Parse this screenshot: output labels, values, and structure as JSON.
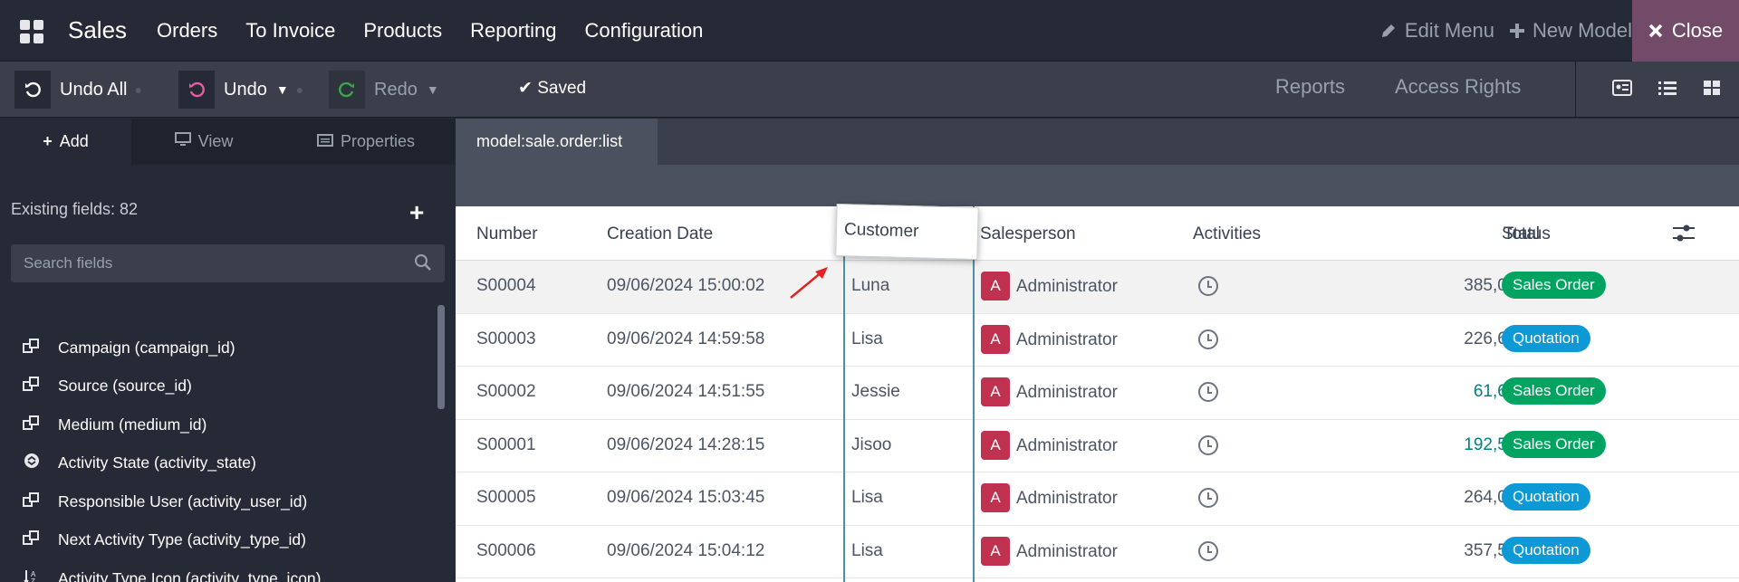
{
  "topbar": {
    "app_title": "Sales",
    "menu": [
      "Orders",
      "To Invoice",
      "Products",
      "Reporting",
      "Configuration"
    ],
    "edit_menu": "Edit Menu",
    "new_model": "New Model",
    "close": "Close"
  },
  "toolbar": {
    "undo_all": "Undo All",
    "undo": "Undo",
    "redo": "Redo",
    "saved": "Saved",
    "reports": "Reports",
    "access_rights": "Access Rights"
  },
  "sidebar": {
    "tabs": [
      "Add",
      "View",
      "Properties"
    ],
    "existing_fields": "Existing fields: 82",
    "search_placeholder": "Search fields",
    "fields": [
      {
        "label": "Campaign (campaign_id)",
        "icon": "many2one-icon"
      },
      {
        "label": "Source (source_id)",
        "icon": "many2one-icon"
      },
      {
        "label": "Medium (medium_id)",
        "icon": "many2one-icon"
      },
      {
        "label": "Activity State (activity_state)",
        "icon": "selection-icon"
      },
      {
        "label": "Responsible User (activity_user_id)",
        "icon": "many2one-icon"
      },
      {
        "label": "Next Activity Type (activity_type_id)",
        "icon": "many2one-icon"
      },
      {
        "label": "Activity Type Icon (activity_type_icon)",
        "icon": "char-icon"
      }
    ]
  },
  "main": {
    "tab": "model:sale.order:list",
    "columns": {
      "number": "Number",
      "creation_date": "Creation Date",
      "customer": "Customer",
      "salesperson": "Salesperson",
      "activities": "Activities",
      "total": "Total",
      "status": "Status"
    },
    "rows": [
      {
        "number": "S00004",
        "date": "09/06/2024 15:00:02",
        "customer": "Luna",
        "avatar": "A",
        "salesperson": "Administrator",
        "total": "385,000 ₫",
        "status": "Sales Order",
        "highlight": false
      },
      {
        "number": "S00003",
        "date": "09/06/2024 14:59:58",
        "customer": "Lisa",
        "avatar": "A",
        "salesperson": "Administrator",
        "total": "226,600 ₫",
        "status": "Quotation",
        "highlight": false
      },
      {
        "number": "S00002",
        "date": "09/06/2024 14:51:55",
        "customer": "Jessie",
        "avatar": "A",
        "salesperson": "Administrator",
        "total": "61,600 ₫",
        "status": "Sales Order",
        "highlight": true
      },
      {
        "number": "S00001",
        "date": "09/06/2024 14:28:15",
        "customer": "Jisoo",
        "avatar": "A",
        "salesperson": "Administrator",
        "total": "192,500 ₫",
        "status": "Sales Order",
        "highlight": true
      },
      {
        "number": "S00005",
        "date": "09/06/2024 15:03:45",
        "customer": "Lisa",
        "avatar": "A",
        "salesperson": "Administrator",
        "total": "264,000 ₫",
        "status": "Quotation",
        "highlight": false
      },
      {
        "number": "S00006",
        "date": "09/06/2024 15:04:12",
        "customer": "Lisa",
        "avatar": "A",
        "salesperson": "Administrator",
        "total": "357,500 ₫",
        "status": "Quotation",
        "highlight": false
      }
    ]
  },
  "colors": {
    "sales_order": "#00a35f",
    "quotation": "#0d99d6",
    "highlight_total": "#017e84",
    "close_bg": "#714b67",
    "avatar_bg": "#c0304f"
  }
}
